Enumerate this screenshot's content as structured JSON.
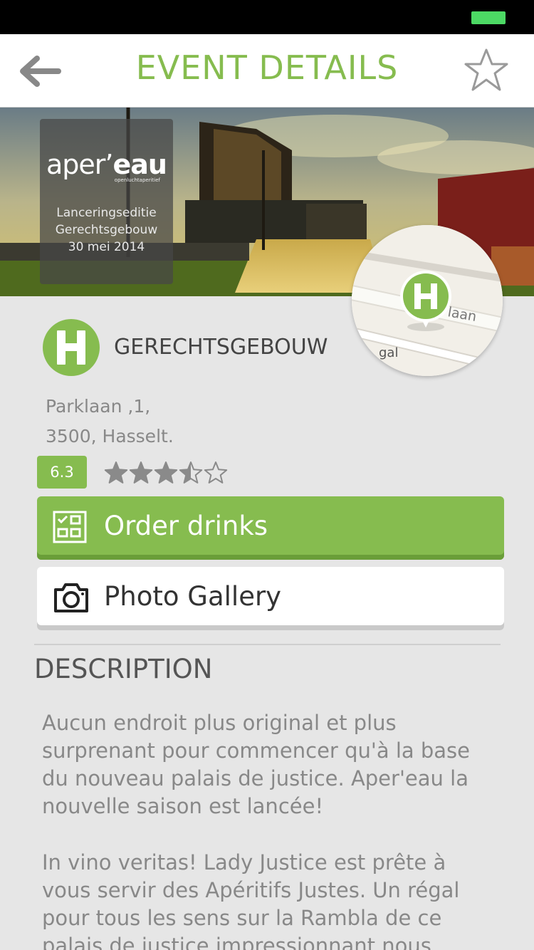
{
  "status_bar": {
    "battery_icon": "battery-icon",
    "battery_color": "#4cd964"
  },
  "header": {
    "title": "EVENT DETAILS",
    "back_icon": "arrow-left-icon",
    "favorite_icon": "star-outline-icon",
    "accent_color": "#86bc4f"
  },
  "hero": {
    "logo_regular": "aper’",
    "logo_bold": "eau",
    "logo_tagline": "openluchtaperitief",
    "edition": "Lanceringseditie",
    "venue": "Gerechtsgebouw",
    "date": "30 mei 2014"
  },
  "map": {
    "street_label": "laan",
    "street_label_2": "gal",
    "pin_icon": "map-pin-h-icon"
  },
  "venue": {
    "logo_letter": "H",
    "name": "GERECHTSGEBOUW",
    "address_line1": "Parklaan ,1,",
    "address_line2": "3500, Hasselt."
  },
  "rating": {
    "score": "6.3",
    "stars_filled": 3.5,
    "stars_total": 5
  },
  "actions": {
    "order": {
      "label": "Order drinks",
      "icon": "checklist-icon"
    },
    "photos": {
      "label": "Photo Gallery",
      "icon": "camera-icon"
    }
  },
  "description": {
    "title": "DESCRIPTION",
    "paragraph1": "Aucun endroit plus original et plus surprenant pour commencer qu'à la base du nouveau palais de justice. Aper'eau la nouvelle saison est lancée!",
    "paragraph2": "In vino veritas! Lady Justice est prête à vous servir des Apéritifs Justes. Un régal pour tous les sens sur la Rambla de ce palais de justice impressionnant nous"
  }
}
